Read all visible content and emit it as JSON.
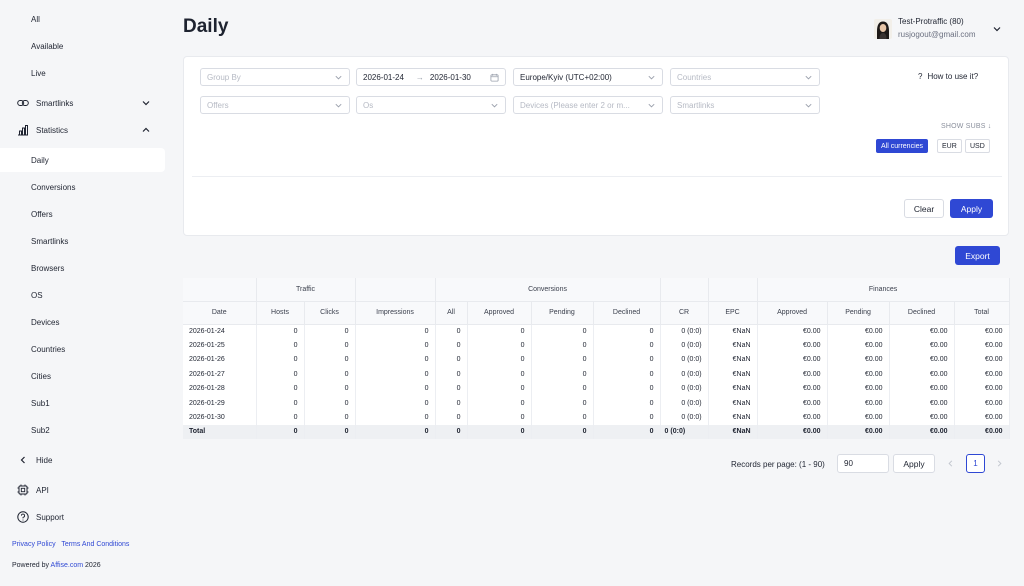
{
  "sidebar": {
    "top_items": [
      {
        "label": "All"
      },
      {
        "label": "Available"
      },
      {
        "label": "Live"
      }
    ],
    "smartlinks": {
      "label": "Smartlinks",
      "icon": "link-icon"
    },
    "statistics": {
      "label": "Statistics",
      "icon": "bar-chart-icon"
    },
    "stats_items": [
      {
        "label": "Daily",
        "active": true
      },
      {
        "label": "Conversions"
      },
      {
        "label": "Offers"
      },
      {
        "label": "Smartlinks"
      },
      {
        "label": "Browsers"
      },
      {
        "label": "OS"
      },
      {
        "label": "Devices"
      },
      {
        "label": "Countries"
      },
      {
        "label": "Cities"
      },
      {
        "label": "Sub1"
      },
      {
        "label": "Sub2"
      }
    ],
    "hide": "Hide",
    "api": "API",
    "support": "Support",
    "privacy": "Privacy Policy",
    "terms": "Terms And Conditions",
    "powered_prefix": "Powered by ",
    "powered_link": "Affise.com",
    "powered_year": " 2026"
  },
  "header": {
    "title": "Daily",
    "user_name": "Test-Protraffic (80)",
    "user_email": "rusjogout@gmail.com"
  },
  "filters": {
    "group_by": "Group By",
    "date_from": "2026-01-24",
    "date_to": "2026-01-30",
    "timezone": "Europe/Kyiv (UTC+02:00)",
    "countries": "Countries",
    "offers": "Offers",
    "os": "Os",
    "devices": "Devices (Please enter 2 or m...",
    "smartlinks": "Smartlinks",
    "how_to_use": "How to use it?",
    "show_subs": "SHOW SUBS",
    "currencies": [
      "All currencies",
      "EUR",
      "USD"
    ],
    "clear": "Clear",
    "apply": "Apply"
  },
  "export": "Export",
  "table": {
    "groups": {
      "traffic": "Traffic",
      "conversions": "Conversions",
      "finances": "Finances"
    },
    "columns": [
      "Date",
      "Hosts",
      "Clicks",
      "Impressions",
      "All",
      "Approved",
      "Pending",
      "Declined",
      "CR",
      "EPC",
      "Approved",
      "Pending",
      "Declined",
      "Total"
    ],
    "rows": [
      [
        "2026-01-24",
        "0",
        "0",
        "0",
        "0",
        "0",
        "0",
        "0",
        "0 (0:0)",
        "€NaN",
        "€0.00",
        "€0.00",
        "€0.00",
        "€0.00"
      ],
      [
        "2026-01-25",
        "0",
        "0",
        "0",
        "0",
        "0",
        "0",
        "0",
        "0 (0:0)",
        "€NaN",
        "€0.00",
        "€0.00",
        "€0.00",
        "€0.00"
      ],
      [
        "2026-01-26",
        "0",
        "0",
        "0",
        "0",
        "0",
        "0",
        "0",
        "0 (0:0)",
        "€NaN",
        "€0.00",
        "€0.00",
        "€0.00",
        "€0.00"
      ],
      [
        "2026-01-27",
        "0",
        "0",
        "0",
        "0",
        "0",
        "0",
        "0",
        "0 (0:0)",
        "€NaN",
        "€0.00",
        "€0.00",
        "€0.00",
        "€0.00"
      ],
      [
        "2026-01-28",
        "0",
        "0",
        "0",
        "0",
        "0",
        "0",
        "0",
        "0 (0:0)",
        "€NaN",
        "€0.00",
        "€0.00",
        "€0.00",
        "€0.00"
      ],
      [
        "2026-01-29",
        "0",
        "0",
        "0",
        "0",
        "0",
        "0",
        "0",
        "0 (0:0)",
        "€NaN",
        "€0.00",
        "€0.00",
        "€0.00",
        "€0.00"
      ],
      [
        "2026-01-30",
        "0",
        "0",
        "0",
        "0",
        "0",
        "0",
        "0",
        "0 (0:0)",
        "€NaN",
        "€0.00",
        "€0.00",
        "€0.00",
        "€0.00"
      ]
    ],
    "total": [
      "Total",
      "0",
      "0",
      "0",
      "0",
      "0",
      "0",
      "0",
      "0 (0:0)",
      "€NaN",
      "€0.00",
      "€0.00",
      "€0.00",
      "€0.00"
    ]
  },
  "pagination": {
    "label": "Records per page: (1 - 90)",
    "value": "90",
    "apply": "Apply",
    "page": "1"
  },
  "colors": {
    "accent": "#2f48d4"
  }
}
